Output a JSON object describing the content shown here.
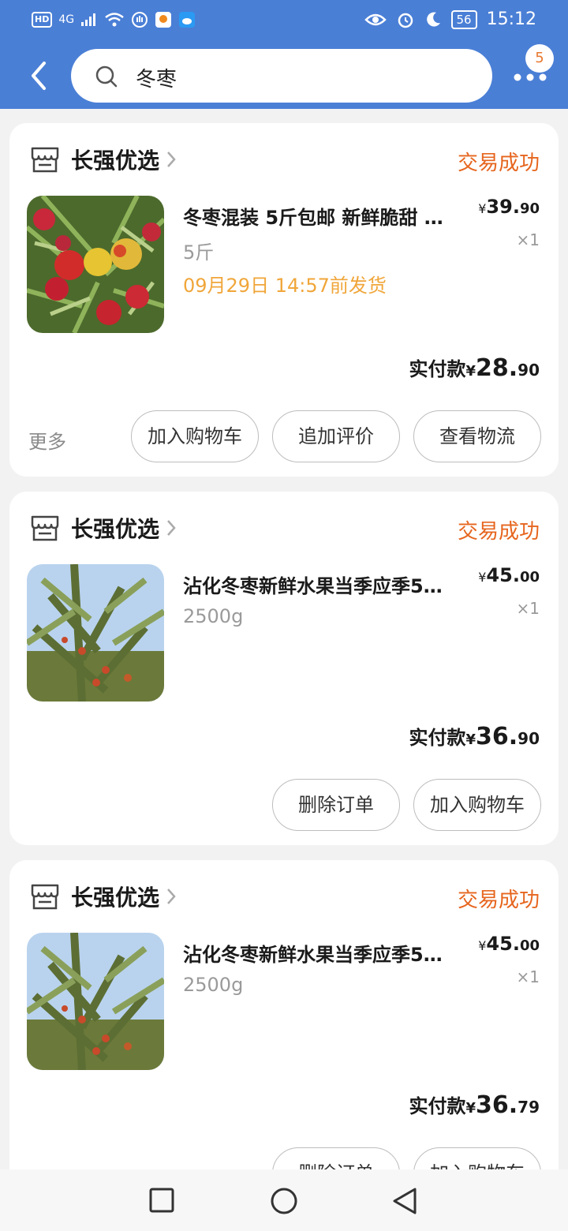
{
  "status_bar": {
    "left": "4G",
    "battery": "56",
    "time": "15:12"
  },
  "header": {
    "search_text": "冬枣",
    "badge_count": "5"
  },
  "orders": [
    {
      "shop": "长强优选",
      "status": "交易成功",
      "product": "冬枣混装 5斤包邮 新鲜脆甜 …",
      "spec": "5斤",
      "ship_note": "09月29日 14:57前发货",
      "price_yen": "¥",
      "price_int": "39.",
      "price_dec": "90",
      "qty": "×1",
      "paid_label": "实付款",
      "paid_yen": "¥",
      "paid_int": "28.",
      "paid_dec": "90",
      "more": "更多",
      "buttons": [
        "加入购物车",
        "追加评价",
        "查看物流"
      ]
    },
    {
      "shop": "长强优选",
      "status": "交易成功",
      "product": "沾化冬枣新鲜水果当季应季5…",
      "spec": "2500g",
      "price_yen": "¥",
      "price_int": "45.",
      "price_dec": "00",
      "qty": "×1",
      "paid_label": "实付款",
      "paid_yen": "¥",
      "paid_int": "36.",
      "paid_dec": "90",
      "buttons": [
        "删除订单",
        "加入购物车"
      ]
    },
    {
      "shop": "长强优选",
      "status": "交易成功",
      "product": "沾化冬枣新鲜水果当季应季5…",
      "spec": "2500g",
      "price_yen": "¥",
      "price_int": "45.",
      "price_dec": "00",
      "qty": "×1",
      "paid_label": "实付款",
      "paid_yen": "¥",
      "paid_int": "36.",
      "paid_dec": "79",
      "buttons": [
        "删除订单",
        "加入购物车"
      ]
    }
  ],
  "colors": {
    "header_blue": "#4a7fd6",
    "status_orange": "#e6651e",
    "ship_orange": "#f0a63a"
  }
}
